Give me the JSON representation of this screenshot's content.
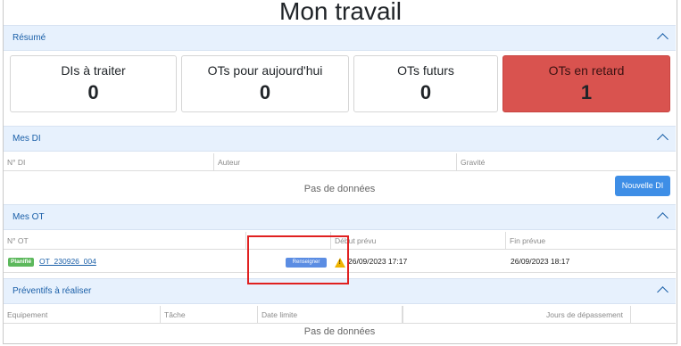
{
  "page": {
    "title": "Mon travail"
  },
  "resume": {
    "title": "Résumé",
    "cards": [
      {
        "label": "DIs à traiter",
        "value": "0"
      },
      {
        "label": "OTs pour aujourd'hui",
        "value": "0"
      },
      {
        "label": "OTs futurs",
        "value": "0"
      },
      {
        "label": "OTs en retard",
        "value": "1"
      }
    ]
  },
  "mes_di": {
    "title": "Mes DI",
    "columns": [
      "N° DI",
      "Auteur",
      "Gravité"
    ],
    "empty_text": "Pas de données",
    "new_button": "Nouvelle DI"
  },
  "mes_ot": {
    "title": "Mes OT",
    "columns": [
      "N° OT",
      "",
      "Début prévu",
      "Fin prévue"
    ],
    "rows": [
      {
        "status": "Planifié",
        "id": "OT_230926_004",
        "action": "Renseigner",
        "start": "26/09/2023 17:17",
        "end": "26/09/2023 18:17"
      }
    ]
  },
  "preventifs": {
    "title": "Préventifs à réaliser",
    "columns": [
      "Equipement",
      "Tâche",
      "Date limite",
      "",
      "Jours de dépassement"
    ],
    "empty_text": "Pas de données"
  },
  "colors": {
    "accent": "#3e8ee6",
    "late_card": "#d9534f",
    "header_bg": "#e7f1fd",
    "planned_badge": "#5cb85c",
    "highlight": "#e02020"
  }
}
